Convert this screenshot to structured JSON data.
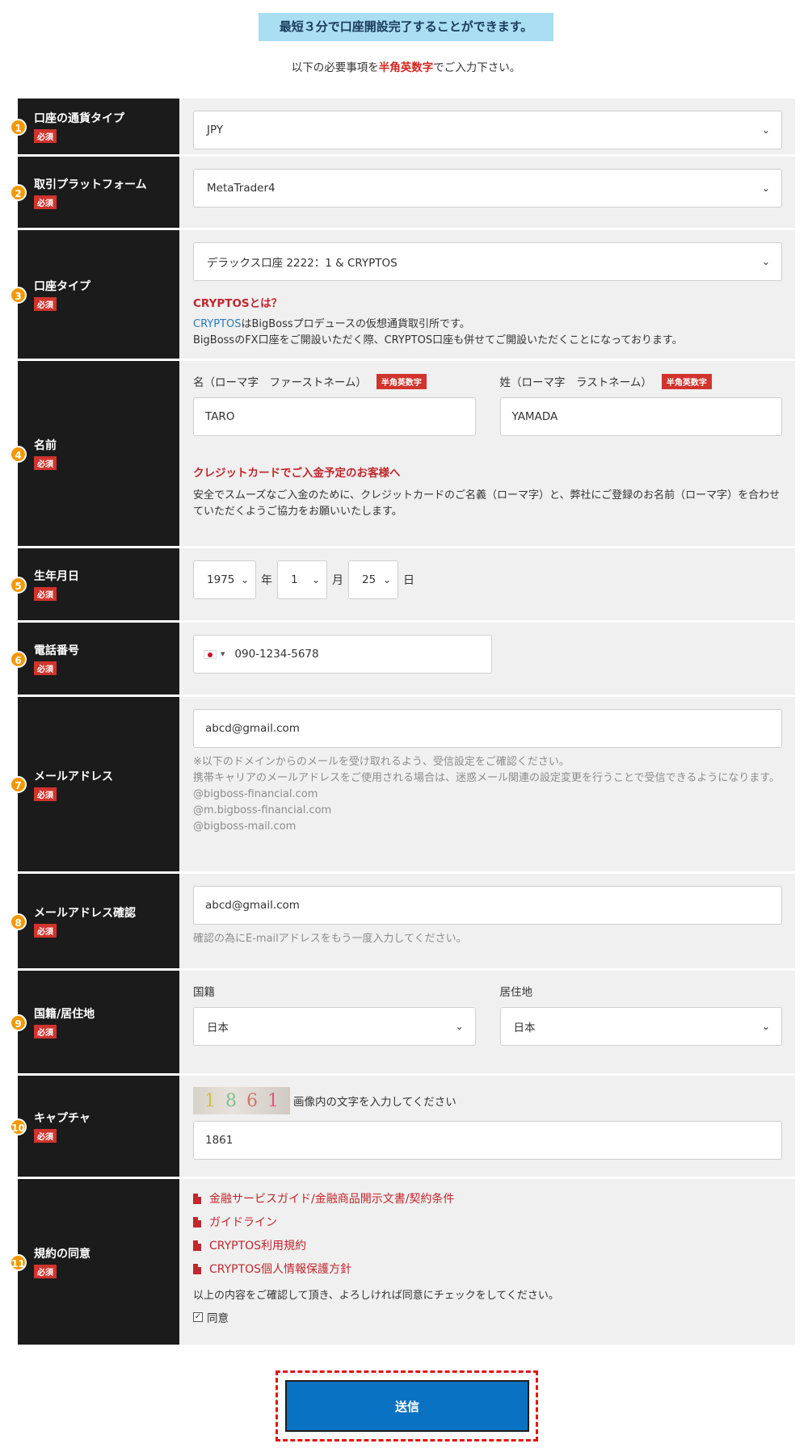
{
  "banner": "最短３分で口座開設完了することができます。",
  "instruction": {
    "before": "以下の必要事項を",
    "highlight": "半角英数字",
    "after": "でご入力下さい。"
  },
  "required_badge": "必須",
  "rows": [
    {
      "num": "1",
      "label": "口座の通貨タイプ",
      "select": "JPY"
    },
    {
      "num": "2",
      "label": "取引プラットフォーム",
      "select": "MetaTrader4"
    },
    {
      "num": "3",
      "label": "口座タイプ",
      "select": "デラックス口座 2222：1 & CRYPTOS",
      "note_title": "CRYPTOSとは？",
      "note_link": "CRYPTOS",
      "note_line1": "はBigBossプロデュースの仮想通貨取引所です。",
      "note_line2": "BigBossのFX口座をご開設いただく際、CRYPTOS口座も併せてご開設いただくことになっております。"
    },
    {
      "num": "4",
      "label": "名前",
      "first_label": "名（ローマ字　ファーストネーム）",
      "last_label": "姓（ローマ字　ラストネーム）",
      "tag": "半角英数字",
      "first_value": "TARO",
      "last_value": "YAMADA",
      "card_title": "クレジットカードでご入金予定のお客様へ",
      "card_note": "安全でスムーズなご入金のために、クレジットカードのご名義（ローマ字）と、弊社にご登録のお名前（ローマ字）を合わせていただくようご協力をお願いいたします。"
    },
    {
      "num": "5",
      "label": "生年月日",
      "year": "1975",
      "year_unit": "年",
      "month": "1",
      "month_unit": "月",
      "day": "25",
      "day_unit": "日"
    },
    {
      "num": "6",
      "label": "電話番号",
      "phone": "090-1234-5678"
    },
    {
      "num": "7",
      "label": "メールアドレス",
      "email": "abcd@gmail.com",
      "note1": "※以下のドメインからのメールを受け取れるよう、受信設定をご確認ください。",
      "note2": "携帯キャリアのメールアドレスをご使用される場合は、迷惑メール関連の設定変更を行うことで受信できるようになります。",
      "domain1": "@bigboss-financial.com",
      "domain2": "@m.bigboss-financial.com",
      "domain3": "@bigboss-mail.com"
    },
    {
      "num": "8",
      "label": "メールアドレス確認",
      "email": "abcd@gmail.com",
      "note": "確認の為にE-mailアドレスをもう一度入力してください。"
    },
    {
      "num": "9",
      "label": "国籍/居住地",
      "nationality_label": "国籍",
      "residence_label": "居住地",
      "nationality": "日本",
      "residence": "日本"
    },
    {
      "num": "10",
      "label": "キャプチャ",
      "captcha_text": "画像内の文字を入力してください",
      "captcha_value": "1861"
    },
    {
      "num": "11",
      "label": "規約の同意",
      "doc1": "金融サービスガイド/金融商品開示文書/契約条件",
      "doc2": "ガイドライン",
      "doc3": "CRYPTOS利用規約",
      "doc4": "CRYPTOS個人情報保護方針",
      "confirm": "以上の内容をご確認して頂き、よろしければ同意にチェックをしてください。",
      "agree": "同意"
    }
  ],
  "submit": "送信",
  "colors": {
    "accent": "#0a72c2",
    "badge": "#d0342c",
    "label_bg": "#1b1b1b",
    "number": "#f39800",
    "banner": "#a9def3"
  },
  "icons": {
    "select": "chevron-down-icon",
    "doc": "file-pdf-icon",
    "flag": "japan-flag-icon",
    "checkbox": "checkbox-checked-icon"
  }
}
